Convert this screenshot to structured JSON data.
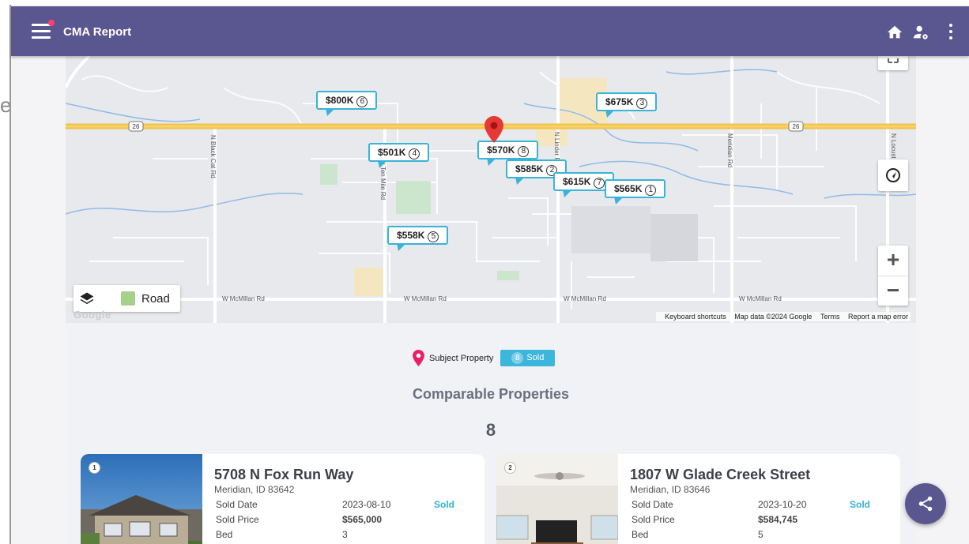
{
  "app": {
    "title": "CMA Report",
    "peek_char": "e"
  },
  "toolbar": {
    "icons": [
      "home-icon",
      "user-settings-icon",
      "more-vert-icon"
    ]
  },
  "map": {
    "markers": [
      {
        "price": "$800K",
        "count": "6"
      },
      {
        "price": "$675K",
        "count": "3"
      },
      {
        "price": "$501K",
        "count": "4"
      },
      {
        "price": "$570K",
        "count": "8"
      },
      {
        "price": "$585K",
        "count": "2"
      },
      {
        "price": "$615K",
        "count": "7"
      },
      {
        "price": "$565K",
        "count": "1"
      },
      {
        "price": "$558K",
        "count": "5"
      }
    ],
    "highway_shield": "26",
    "roads": {
      "black_cat": "N Black Cat Rd",
      "ten_mile": "N Ten Mile Rd",
      "linder": "N Linder Rd",
      "meridian": "Meridian Rd",
      "locust": "N Locust",
      "mcmillan": "W McMillan Rd"
    },
    "layer_label": "Road",
    "google": "Google",
    "footer": {
      "shortcuts": "Keyboard shortcuts",
      "data": "Map data ©2024 Google",
      "terms": "Terms",
      "report": "Report a map error"
    },
    "zoom_in": "+",
    "zoom_out": "−"
  },
  "legend": {
    "subject": "Subject Property",
    "sold_count": "8",
    "sold_label": "Sold"
  },
  "comparables": {
    "title": "Comparable Properties",
    "count": "8",
    "cards": [
      {
        "index": "1",
        "address": "5708 N Fox Run Way",
        "city": "Meridian, ID 83642",
        "status": "Sold",
        "rows": [
          {
            "label": "Sold Date",
            "value": "2023-08-10"
          },
          {
            "label": "Sold Price",
            "value": "$565,000"
          },
          {
            "label": "Bed",
            "value": "3"
          }
        ]
      },
      {
        "index": "2",
        "address": "1807 W Glade Creek Street",
        "city": "Meridian, ID 83646",
        "status": "Sold",
        "rows": [
          {
            "label": "Sold Date",
            "value": "2023-10-20"
          },
          {
            "label": "Sold Price",
            "value": "$584,745"
          },
          {
            "label": "Bed",
            "value": "5"
          }
        ]
      }
    ]
  },
  "colors": {
    "header": "#5a5690",
    "accent": "#39b3d7",
    "pin": "#e53935"
  }
}
